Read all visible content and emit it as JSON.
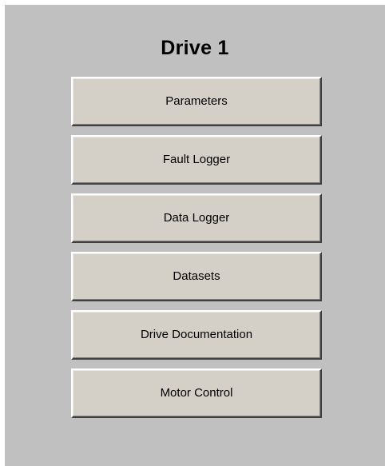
{
  "panel": {
    "title": "Drive 1"
  },
  "menu": {
    "items": [
      {
        "label": "Parameters"
      },
      {
        "label": "Fault Logger"
      },
      {
        "label": "Data Logger"
      },
      {
        "label": "Datasets"
      },
      {
        "label": "Drive Documentation"
      },
      {
        "label": "Motor Control"
      }
    ]
  },
  "colors": {
    "panel_background": "#c0c0c0",
    "button_face": "#d4d0c8"
  }
}
